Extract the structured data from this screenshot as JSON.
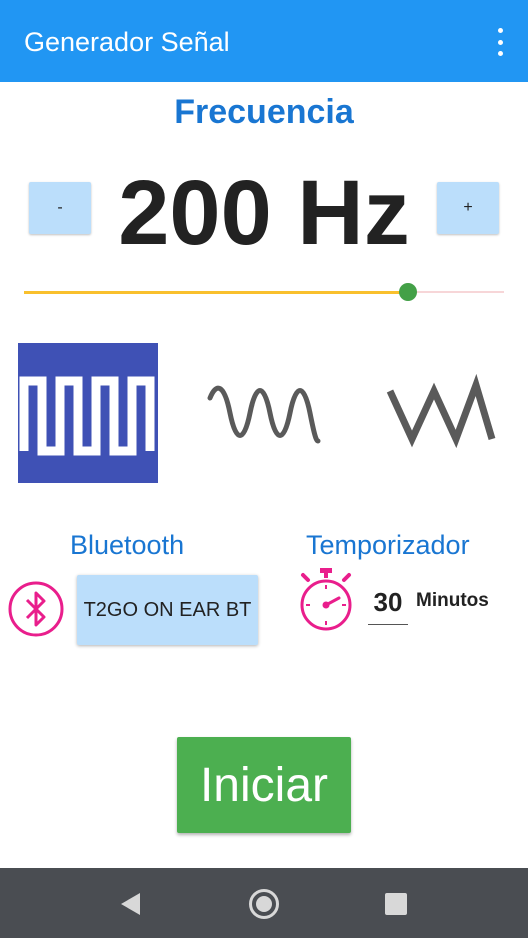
{
  "app_bar": {
    "title": "Generador Señal",
    "menu_icon": "more-vert-icon"
  },
  "frequency": {
    "label": "Frecuencia",
    "value": "200 Hz",
    "decrement_label": "-",
    "increment_label": "+",
    "slider_fraction": 0.8
  },
  "waveforms": [
    {
      "name": "square",
      "icon": "square-wave-icon",
      "selected": true
    },
    {
      "name": "sine",
      "icon": "sine-wave-icon",
      "selected": false
    },
    {
      "name": "triangle",
      "icon": "triangle-wave-icon",
      "selected": false
    }
  ],
  "bluetooth": {
    "label": "Bluetooth",
    "icon": "bluetooth-icon",
    "device_name": "T2GO ON EAR BT"
  },
  "timer": {
    "label": "Temporizador",
    "icon": "stopwatch-icon",
    "minutes_value": "30",
    "unit_label": "Minutos"
  },
  "start_button": {
    "label": "Iniciar"
  },
  "navigation_bar": {
    "back_icon": "back-triangle-icon",
    "home_icon": "home-circle-icon",
    "recent_icon": "recent-apps-square-icon"
  },
  "colors": {
    "app_bar": "#2196F3",
    "accent_blue": "#1976D2",
    "light_blue_button": "#BBDEFB",
    "selected_wave_bg": "#3F51B5",
    "slider_active": "#F9C02D",
    "slider_thumb": "#43A047",
    "pink_icons": "#E91E8C",
    "start_button": "#4CAF50",
    "nav_bar": "#4A4D52"
  }
}
